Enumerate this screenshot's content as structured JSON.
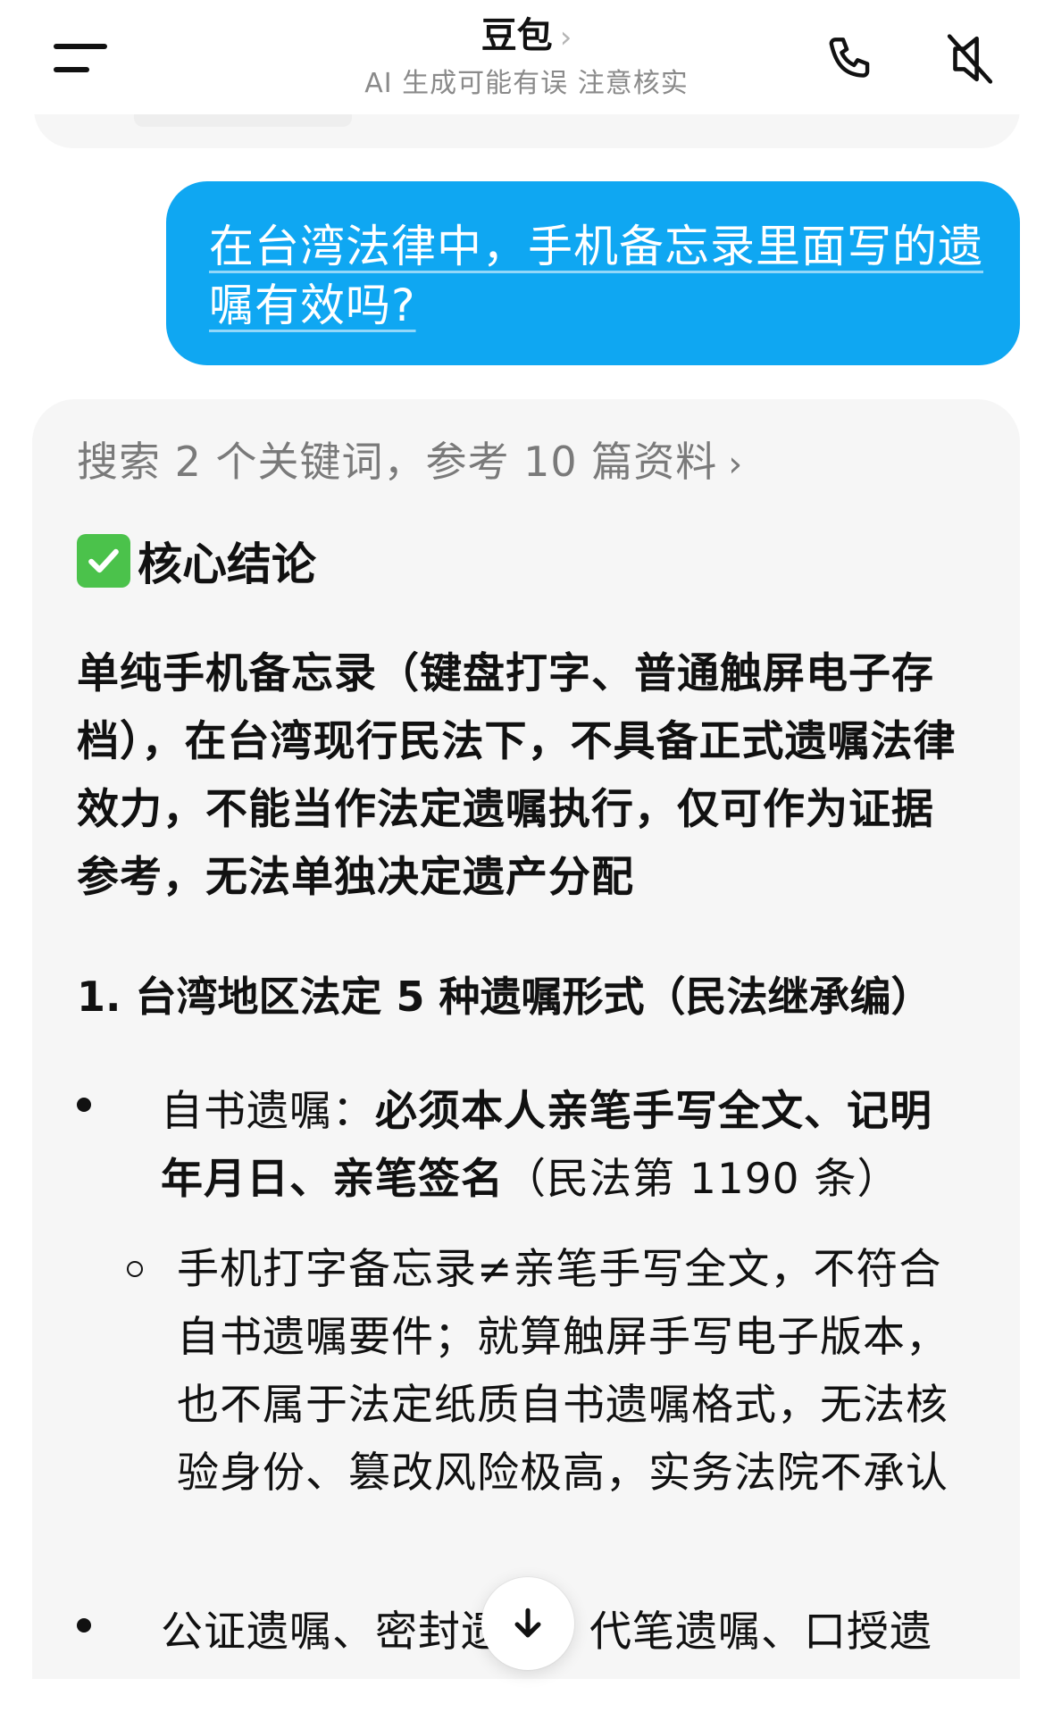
{
  "header": {
    "title": "豆包",
    "title_chevron": "›",
    "subtitle": "AI 生成可能有误 注意核实",
    "menu_icon": "menu-icon",
    "phone_icon": "phone-icon",
    "mute_icon": "speaker-mute-icon"
  },
  "user_message": {
    "line1": "在台湾法律中，手机备忘录里面写的遗",
    "line2": "嘱有效吗?"
  },
  "assistant": {
    "search_summary": "搜索 2 个关键词，参考 10 篇资料",
    "search_chevron": "›",
    "core_title": "核心结论",
    "core_paragraph": "单纯手机备忘录（键盘打字、普通触屏电子存档），在台湾现行民法下，不具备正式遗嘱法律效力，不能当作法定遗嘱执行，仅可作为证据参考，无法单独决定遗产分配",
    "section1_title": "1. 台湾地区法定 5 种遗嘱形式（民法继承编）",
    "bullet1_label": "自书遗嘱：",
    "bullet1_bold": "必须本人亲笔手写全文、记明年月日、亲笔签名",
    "bullet1_tail": "（民法第 1190 条）",
    "sub_bullet": "手机打字备忘录≠亲笔手写全文，不符合自书遗嘱要件；就算触屏手写电子版本，也不属于法定纸质自书遗嘱格式，无法核验身份、篡改风险极高，实务法院不承认",
    "bullet3_text": "公证遗嘱、密封遗嘱、代笔遗嘱、口授遗"
  },
  "colors": {
    "user_bubble": "#0fa7f2",
    "card_bg": "#f6f6f6",
    "check_green": "#4bc24b"
  },
  "scroll_button_icon": "arrow-down-icon"
}
